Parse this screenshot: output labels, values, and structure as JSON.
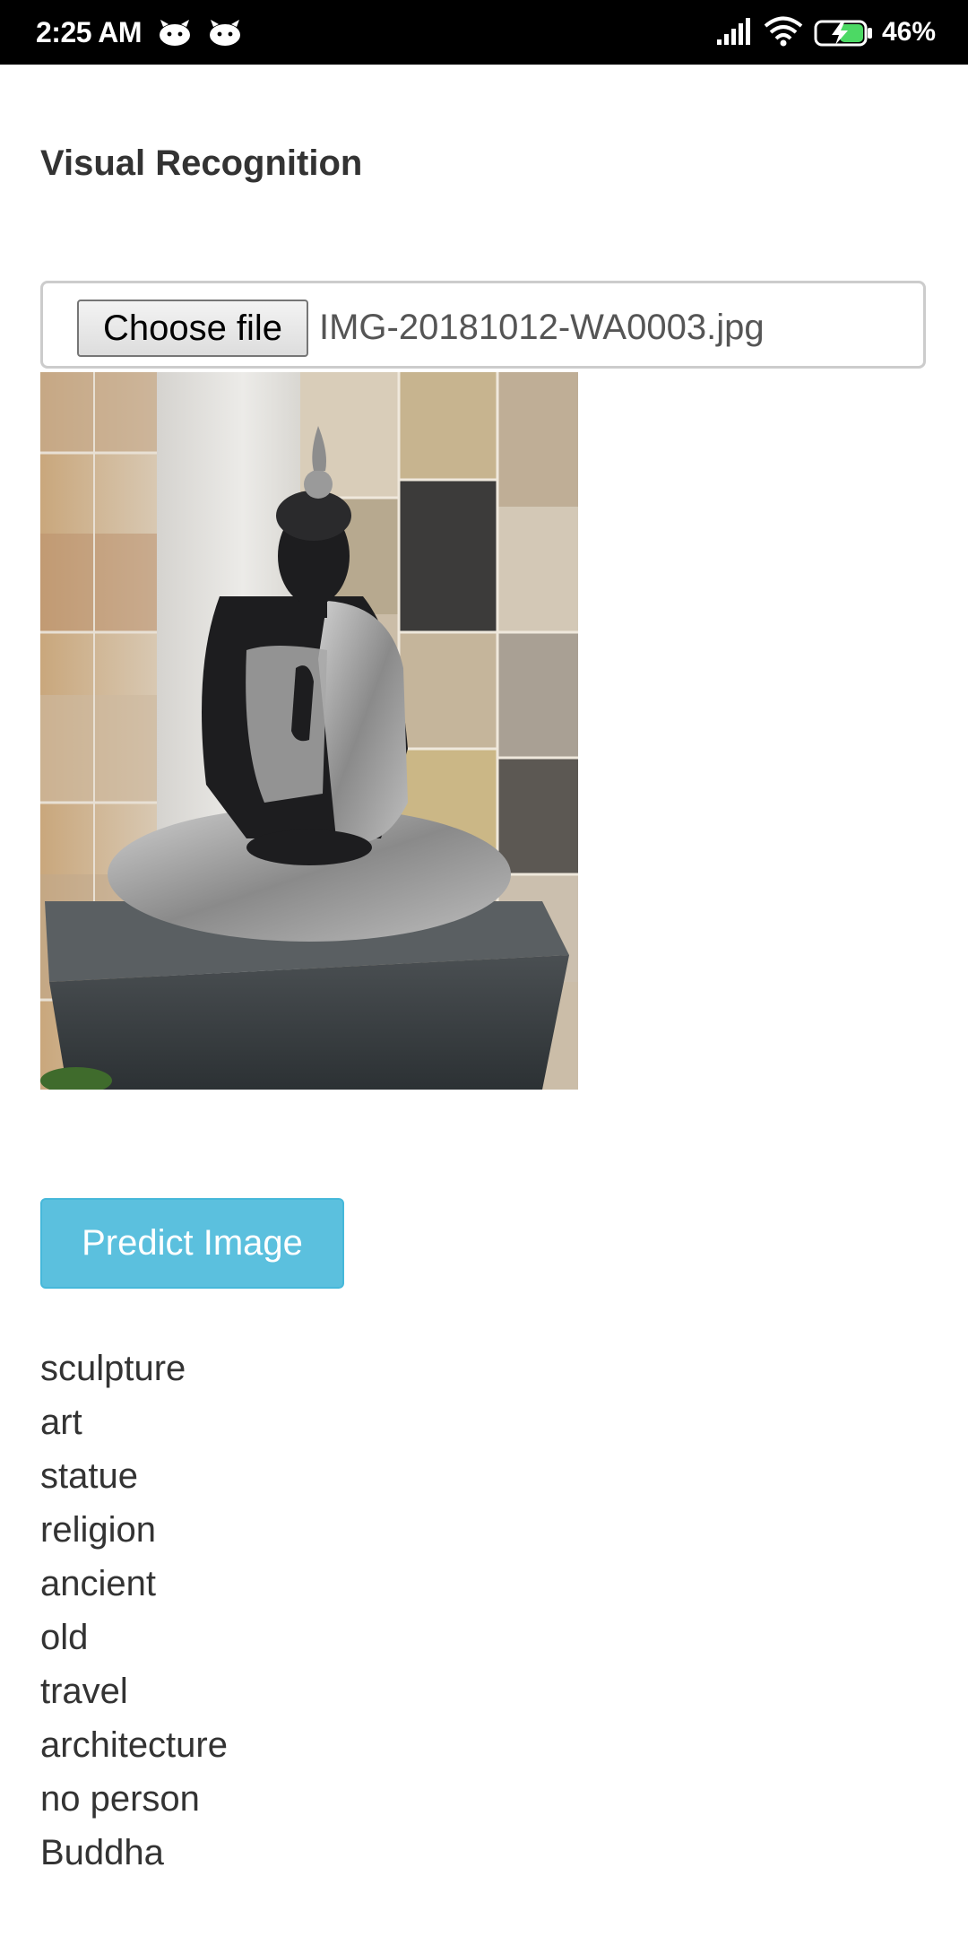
{
  "status_bar": {
    "time": "2:25 AM",
    "battery": "46%",
    "icons": [
      "android-notification-icon",
      "android-notification-icon",
      "signal-icon",
      "wifi-icon",
      "battery-charging-icon"
    ]
  },
  "page": {
    "title": "Visual Recognition"
  },
  "file_input": {
    "button_label": "Choose file",
    "file_name": "IMG-20181012-WA0003.jpg"
  },
  "predict_button": {
    "label": "Predict Image",
    "color": "#5bc0de"
  },
  "predictions": [
    "sculpture",
    "art",
    "statue",
    "religion",
    "ancient",
    "old",
    "travel",
    "architecture",
    "no person",
    "Buddha"
  ]
}
